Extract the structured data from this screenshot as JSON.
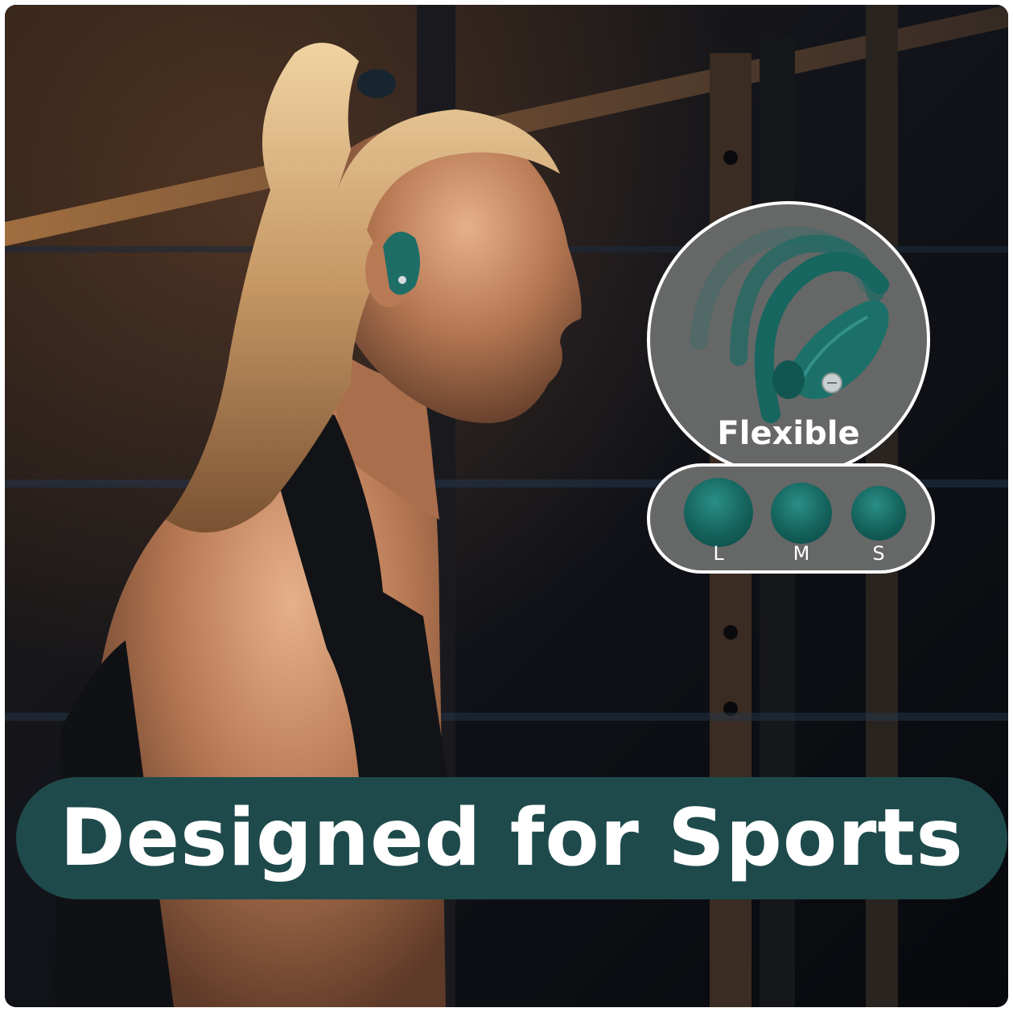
{
  "feature_callout": {
    "label": "Flexible",
    "icon": "earbud-hook-icon",
    "accent_color": "#177069"
  },
  "ear_tips": {
    "sizes": [
      {
        "label": "L"
      },
      {
        "label": "M"
      },
      {
        "label": "S"
      }
    ]
  },
  "headline": {
    "text": "Designed for Sports",
    "banner_color": "#1f4a4b"
  }
}
